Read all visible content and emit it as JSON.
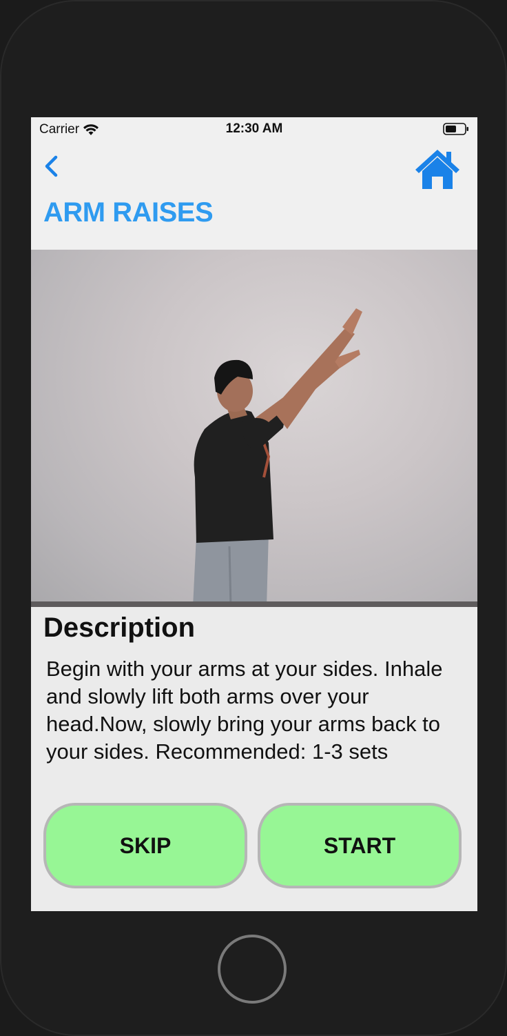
{
  "status_bar": {
    "carrier": "Carrier",
    "time": "12:30 AM",
    "wifi_icon": "wifi-icon",
    "battery_icon": "battery-icon"
  },
  "nav": {
    "back_icon": "chevron-left-icon",
    "home_icon": "home-icon",
    "accent_color": "#2f9bf0"
  },
  "exercise": {
    "title": "ARM RAISES",
    "image_alt": "Man standing raising both arms overhead"
  },
  "description": {
    "heading": "Description",
    "text": "Begin with your arms at your sides. Inhale and slowly lift both arms over your head.Now, slowly bring your arms back to your sides. Recommended: 1-3 sets"
  },
  "actions": {
    "skip_label": "SKIP",
    "start_label": "START",
    "button_color": "#97f695"
  }
}
